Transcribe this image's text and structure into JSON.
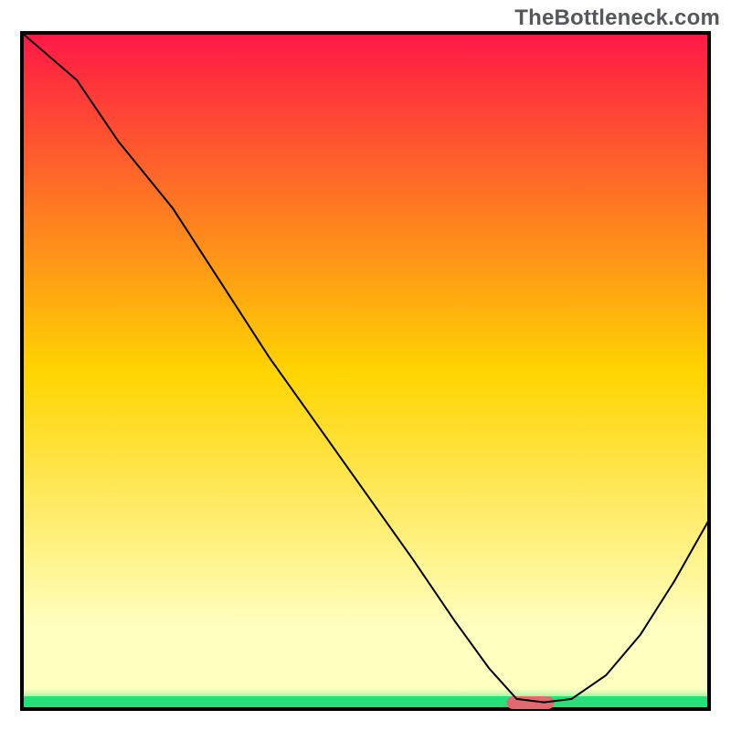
{
  "watermark": "TheBottleneck.com",
  "chart_data": {
    "type": "line",
    "title": "",
    "xlabel": "",
    "ylabel": "",
    "axes_visible": false,
    "grid": false,
    "xlim": [
      0,
      100
    ],
    "ylim": [
      0,
      100
    ],
    "background_gradient_top": "#ff1846",
    "background_gradient_mid": "#ffd400",
    "background_gradient_near_bottom": "#ffffc0",
    "background_bottom_band": "#28e07a",
    "line_color": "#000000",
    "line_width": 2,
    "optimum_marker": {
      "x": 74,
      "color": "#e06a6f",
      "shape": "rounded-bar"
    },
    "series": [
      {
        "name": "bottleneck-curve",
        "x": [
          0,
          8,
          14,
          22,
          29,
          36,
          43,
          50,
          57,
          63,
          68,
          72,
          76,
          80,
          85,
          90,
          95,
          100
        ],
        "values": [
          100,
          93,
          84,
          74,
          63,
          52,
          42,
          32,
          22,
          13,
          6,
          1.5,
          1,
          1.5,
          5,
          11,
          19,
          28
        ]
      }
    ]
  }
}
